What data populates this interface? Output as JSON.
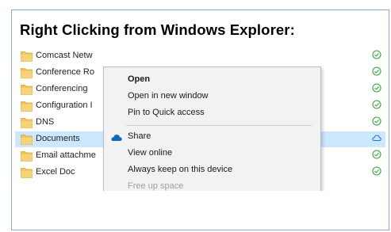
{
  "heading": "Right Clicking from Windows Explorer:",
  "colors": {
    "frame_border": "#8fa8d6",
    "selected_row": "#cce8ff",
    "folder": "#f0c35a",
    "sync_green": "#3aa53a",
    "cloud_blue": "#2a6fd6",
    "menu_bg": "#f2f2f2"
  },
  "files": [
    {
      "name": "Comcast Netw",
      "status_icon": "synced-check-icon"
    },
    {
      "name": "Conference Ro",
      "status_icon": "synced-check-icon"
    },
    {
      "name": "Conferencing",
      "status_icon": "synced-check-icon"
    },
    {
      "name": "Configuration I",
      "status_icon": "synced-check-icon"
    },
    {
      "name": "DNS",
      "status_icon": "synced-check-icon"
    },
    {
      "name": "Documents",
      "status_icon": "cloud-icon",
      "selected": true
    },
    {
      "name": "Email attachme",
      "status_icon": "synced-check-icon"
    },
    {
      "name": "Excel Doc",
      "status_icon": "synced-check-icon"
    }
  ],
  "context_menu": {
    "items": [
      {
        "label": "Open",
        "bold": true
      },
      {
        "label": "Open in new window"
      },
      {
        "label": "Pin to Quick access"
      },
      {
        "label": "Share",
        "icon": "onedrive-cloud-icon"
      },
      {
        "label": "View online"
      },
      {
        "label": "Always keep on this device"
      },
      {
        "label": "Free up space",
        "disabled": true
      }
    ]
  }
}
